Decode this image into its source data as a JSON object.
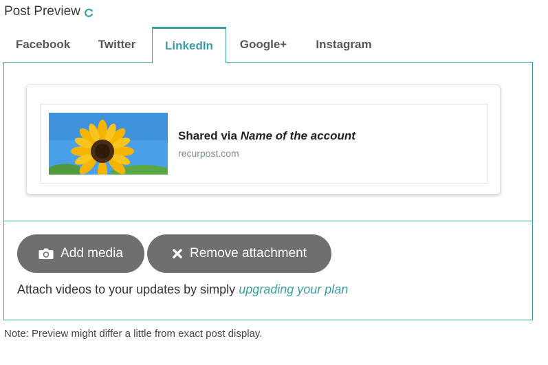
{
  "header": {
    "title": "Post Preview",
    "refresh_icon": "refresh-icon"
  },
  "tabs": [
    {
      "label": "Facebook",
      "active": false
    },
    {
      "label": "Twitter",
      "active": false
    },
    {
      "label": "LinkedIn",
      "active": true
    },
    {
      "label": "Google+",
      "active": false
    },
    {
      "label": "Instagram",
      "active": false
    }
  ],
  "preview": {
    "shared_prefix": "Shared via",
    "account_name": "Name of the account",
    "domain": "recurpost.com"
  },
  "actions": {
    "add_media_label": "Add media",
    "add_media_icon": "camera-icon",
    "remove_attachment_label": "Remove attachment",
    "remove_attachment_icon": "close-icon"
  },
  "attach": {
    "text": "Attach videos to your updates by simply",
    "link": "upgrading your plan"
  },
  "note": "Note: Preview might differ a little from exact post display.",
  "colors": {
    "accent": "#3a9fa3",
    "button": "#6f6f6f"
  }
}
